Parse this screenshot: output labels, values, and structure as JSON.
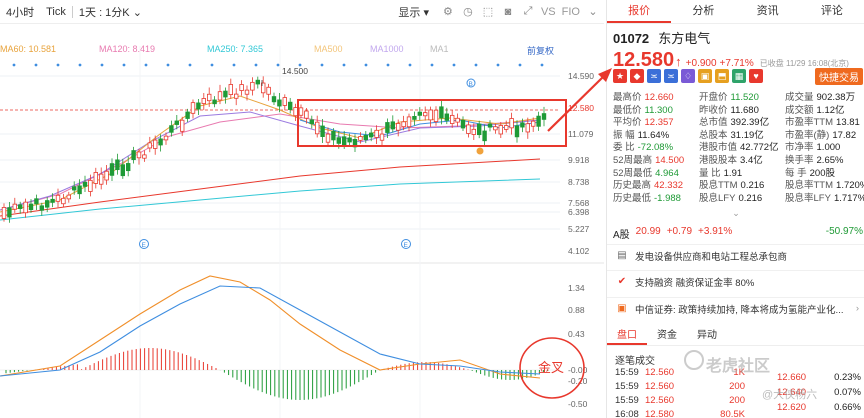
{
  "toolbar": {
    "period_4h": "4小时",
    "tick": "Tick",
    "period_select": "1天 : 1分K",
    "indicator_label": "显示",
    "vs_label": "VS",
    "fio_label": "FIO"
  },
  "ma_legend": {
    "ma60": "MA60: 10.581",
    "ma120": "MA120: 8.419",
    "ma250": "MA250: 7.365",
    "ma500": "MA500",
    "ma1000": "MA1000",
    "ma": "MA1",
    "restore": "前复权"
  },
  "price_axis": [
    "14.590",
    "12.580",
    "11.079",
    "9.918",
    "8.738",
    "7.568",
    "6.398",
    "5.227",
    "4.102"
  ],
  "macd_axis": [
    "1.34",
    "0.88",
    "0.43",
    "-0.00",
    "-0.20",
    "-0.50"
  ],
  "high_marker": "14.500",
  "event_markers": {
    "b": "B",
    "e1": "E",
    "e2": "E"
  },
  "annotation": {
    "golden_cross": "金叉"
  },
  "colors": {
    "red": "#e8382d",
    "green": "#1f9a36",
    "ma_yellow": "#e8a33c",
    "ma_pink": "#e87ab0",
    "ma_cyan": "#32c8d6",
    "ma_purple": "#9b7be0",
    "macd_blue": "#3f8ee0",
    "macd_orange": "#f08f2a"
  },
  "quote_tabs": [
    "报价",
    "分析",
    "资讯",
    "评论"
  ],
  "stock": {
    "code": "01072",
    "name": "东方电气",
    "price": "12.580",
    "arrow": "↑",
    "change": "+0.900",
    "change_pct": "+7.71%",
    "time": "已收盘 11/29 16:08(北京)",
    "fast_trade": "快捷交易"
  },
  "stats": [
    [
      {
        "k": "最高价",
        "v": "12.660",
        "c": "red"
      },
      {
        "k": "开盘价",
        "v": "11.520",
        "c": "green"
      },
      {
        "k": "成交量",
        "v": "902.38万",
        "c": ""
      }
    ],
    [
      {
        "k": "最低价",
        "v": "11.300",
        "c": "green"
      },
      {
        "k": "昨收价",
        "v": "11.680",
        "c": ""
      },
      {
        "k": "成交额",
        "v": "1.12亿",
        "c": ""
      }
    ],
    [
      {
        "k": "平均价",
        "v": "12.357",
        "c": "red"
      },
      {
        "k": "总市值",
        "v": "392.39亿",
        "c": ""
      },
      {
        "k": "市盈率TTM",
        "v": "13.81",
        "c": ""
      }
    ],
    [
      {
        "k": "振 幅",
        "v": "11.64%",
        "c": ""
      },
      {
        "k": "总股本",
        "v": "31.19亿",
        "c": ""
      },
      {
        "k": "市盈率(静)",
        "v": "17.82",
        "c": ""
      }
    ],
    [
      {
        "k": "委 比",
        "v": "-72.08%",
        "c": "green"
      },
      {
        "k": "港股市值",
        "v": "42.772亿",
        "c": ""
      },
      {
        "k": "市净率",
        "v": "1.000",
        "c": ""
      }
    ],
    [
      {
        "k": "52周最高",
        "v": "14.500",
        "c": "red"
      },
      {
        "k": "港股股本",
        "v": "3.4亿",
        "c": ""
      },
      {
        "k": "换手率",
        "v": "2.65%",
        "c": ""
      }
    ],
    [
      {
        "k": "52周最低",
        "v": "4.964",
        "c": "green"
      },
      {
        "k": "量 比",
        "v": "1.91",
        "c": ""
      },
      {
        "k": "每 手",
        "v": "200股",
        "c": ""
      }
    ],
    [
      {
        "k": "历史最高",
        "v": "42.332",
        "c": "red"
      },
      {
        "k": "股息TTM",
        "v": "0.216",
        "c": ""
      },
      {
        "k": "股息率TTM",
        "v": "1.720%",
        "c": ""
      }
    ],
    [
      {
        "k": "历史最低",
        "v": "-1.988",
        "c": "green"
      },
      {
        "k": "股息LFY",
        "v": "0.216",
        "c": ""
      },
      {
        "k": "股息率LFY",
        "v": "1.717%",
        "c": ""
      }
    ]
  ],
  "expand": "⌄",
  "ashare": {
    "label": "A股",
    "price": "20.99",
    "change": "+0.79",
    "pct": "+3.91%",
    "premium": "-50.97%"
  },
  "news": [
    {
      "text": "发电设备供应商和电站工程总承包商",
      "icon": "news-icon"
    },
    {
      "text": "支持融资 融资保证金率 80%",
      "icon": "check-icon"
    },
    {
      "text": "中信证券: 政策持续加持, 降本将成为氢能产业化...",
      "icon": "report-icon"
    }
  ],
  "bottom_tabs": [
    "盘口",
    "资金",
    "异动"
  ],
  "trades_title": "逐笔成交",
  "trades": [
    {
      "time": "15:59",
      "price": "12.560",
      "vol": "1K"
    },
    {
      "time": "15:59",
      "price": "12.560",
      "vol": "200"
    },
    {
      "time": "15:59",
      "price": "12.560",
      "vol": "200"
    },
    {
      "time": "16:08",
      "price": "12.580",
      "vol": "80.5K"
    }
  ],
  "orders": [
    {
      "price": "12.660",
      "vol": "0.23%"
    },
    {
      "price": "12.640",
      "vol": "0.07%"
    },
    {
      "price": "12.620",
      "vol": "0.66%"
    }
  ],
  "watermark": "老虎社区",
  "watermark_user": "@大侠杨六"
}
